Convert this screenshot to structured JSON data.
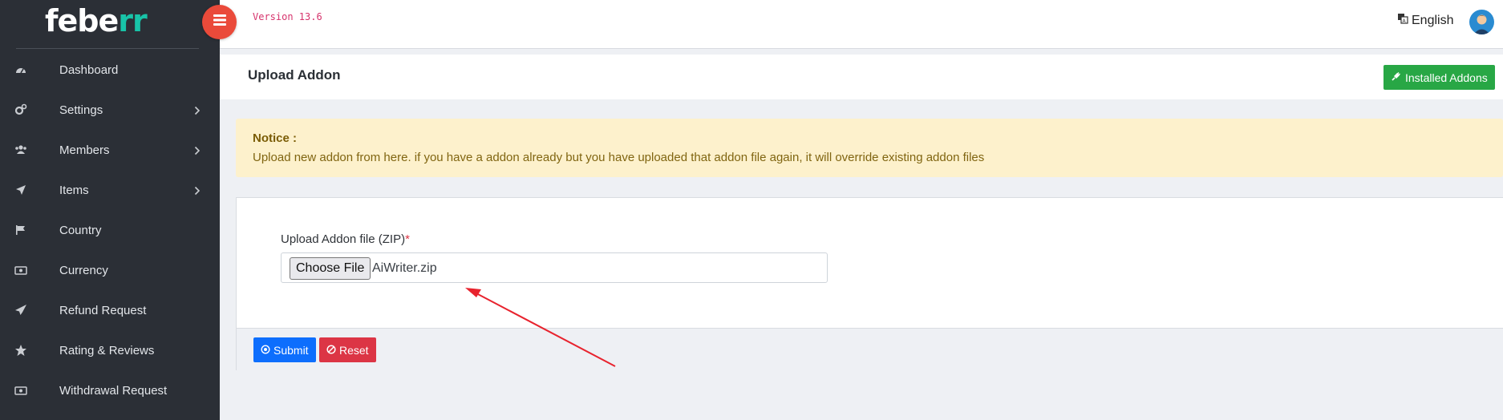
{
  "brand": {
    "logo_part1": "febe",
    "logo_part2": "rr"
  },
  "topbar": {
    "version": "Version 13.6",
    "language": "English"
  },
  "sidebar": {
    "items": [
      {
        "label": "Dashboard",
        "icon": "dashboard-icon",
        "has_submenu": false
      },
      {
        "label": "Settings",
        "icon": "gears-icon",
        "has_submenu": true
      },
      {
        "label": "Members",
        "icon": "users-icon",
        "has_submenu": true
      },
      {
        "label": "Items",
        "icon": "location-arrow-icon",
        "has_submenu": true
      },
      {
        "label": "Country",
        "icon": "flag-icon",
        "has_submenu": false
      },
      {
        "label": "Currency",
        "icon": "money-icon",
        "has_submenu": false
      },
      {
        "label": "Refund Request",
        "icon": "paper-plane-icon",
        "has_submenu": false
      },
      {
        "label": "Rating & Reviews",
        "icon": "star-icon",
        "has_submenu": false
      },
      {
        "label": "Withdrawal Request",
        "icon": "money-icon",
        "has_submenu": false
      }
    ]
  },
  "page": {
    "title": "Upload Addon",
    "installed_button": "Installed Addons"
  },
  "notice": {
    "title": "Notice :",
    "text": "Upload new addon from here. if you have a addon already but you have uploaded that addon file again, it will override existing addon files"
  },
  "form": {
    "label": "Upload Addon file (ZIP)",
    "required_mark": "*",
    "choose_button": "Choose File",
    "file_name": "AiWriter.zip",
    "submit": "Submit",
    "reset": "Reset"
  },
  "colors": {
    "sidebar_bg": "#2b2f36",
    "accent_green": "#28a745",
    "submit_blue": "#0d6efd",
    "reset_red": "#dc3545",
    "toggle_red": "#ea4a3a",
    "notice_bg": "#fdf1cc",
    "annotation_arrow": "#e8232e"
  }
}
